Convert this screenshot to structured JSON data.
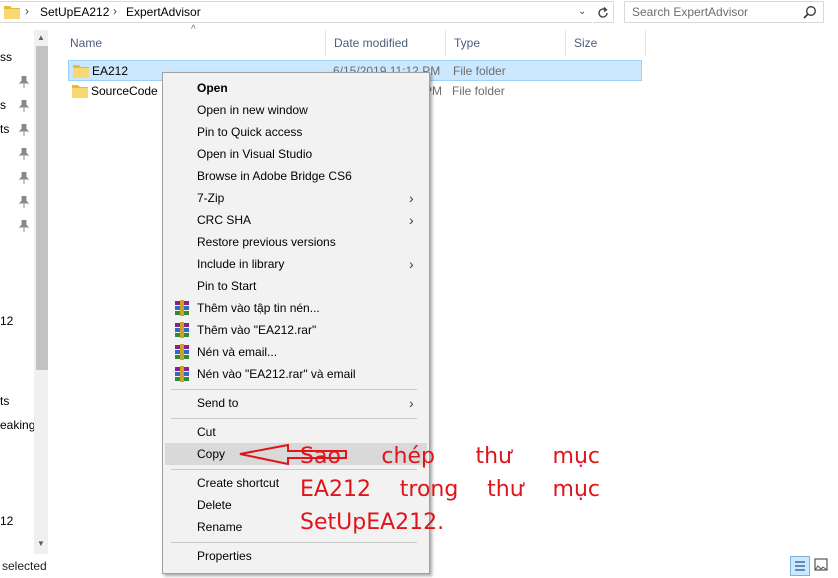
{
  "address_bar": {
    "crumbs": [
      "SetUpEA212",
      "ExpertAdvisor"
    ],
    "separator": "›",
    "dropdown_glyph": "⌄"
  },
  "search": {
    "placeholder": "Search ExpertAdvisor"
  },
  "nav_pane": {
    "fragments": [
      "ss",
      "s",
      "ts",
      "12",
      "ts",
      "eaking",
      "12"
    ]
  },
  "columns": [
    "Name",
    "Date modified",
    "Type",
    "Size"
  ],
  "files": [
    {
      "name": "EA212",
      "date": "6/15/2019 11:12 PM",
      "type": "File folder",
      "selected": true
    },
    {
      "name": "SourceCode",
      "date": "PM",
      "type": "File folder",
      "selected": false
    }
  ],
  "status_bar": {
    "text": "selected"
  },
  "context_menu": {
    "items": [
      {
        "label": "Open",
        "bold": true
      },
      {
        "label": "Open in new window"
      },
      {
        "label": "Pin to Quick access"
      },
      {
        "label": "Open in Visual Studio"
      },
      {
        "label": "Browse in Adobe Bridge CS6"
      },
      {
        "label": "7-Zip",
        "submenu": true
      },
      {
        "label": "CRC SHA",
        "submenu": true
      },
      {
        "label": "Restore previous versions"
      },
      {
        "label": "Include in library",
        "submenu": true
      },
      {
        "label": "Pin to Start"
      },
      {
        "label": "Thêm vào tập tin nén...",
        "icon": "winrar-icon"
      },
      {
        "label": "Thêm vào \"EA212.rar\"",
        "icon": "winrar-icon"
      },
      {
        "label": "Nén và email...",
        "icon": "winrar-icon"
      },
      {
        "label": "Nén vào \"EA212.rar\" và email",
        "icon": "winrar-icon"
      },
      {
        "label": "Send to",
        "submenu": true
      },
      {
        "label": "Cut"
      },
      {
        "label": "Copy",
        "highlighted": true
      },
      {
        "label": "Create shortcut"
      },
      {
        "label": "Delete"
      },
      {
        "label": "Rename"
      },
      {
        "label": "Properties"
      }
    ],
    "submenu_glyph": "›"
  },
  "annotation": {
    "lines": [
      "Sao chép thư mục",
      "EA212 trong thư mục",
      "SetUpEA212."
    ],
    "color": "#e0151b"
  },
  "colors": {
    "selection_bg": "#cce8ff",
    "selection_border": "#99d1ff",
    "menu_bg": "#f2f2f2",
    "header_text": "#4c607a"
  }
}
